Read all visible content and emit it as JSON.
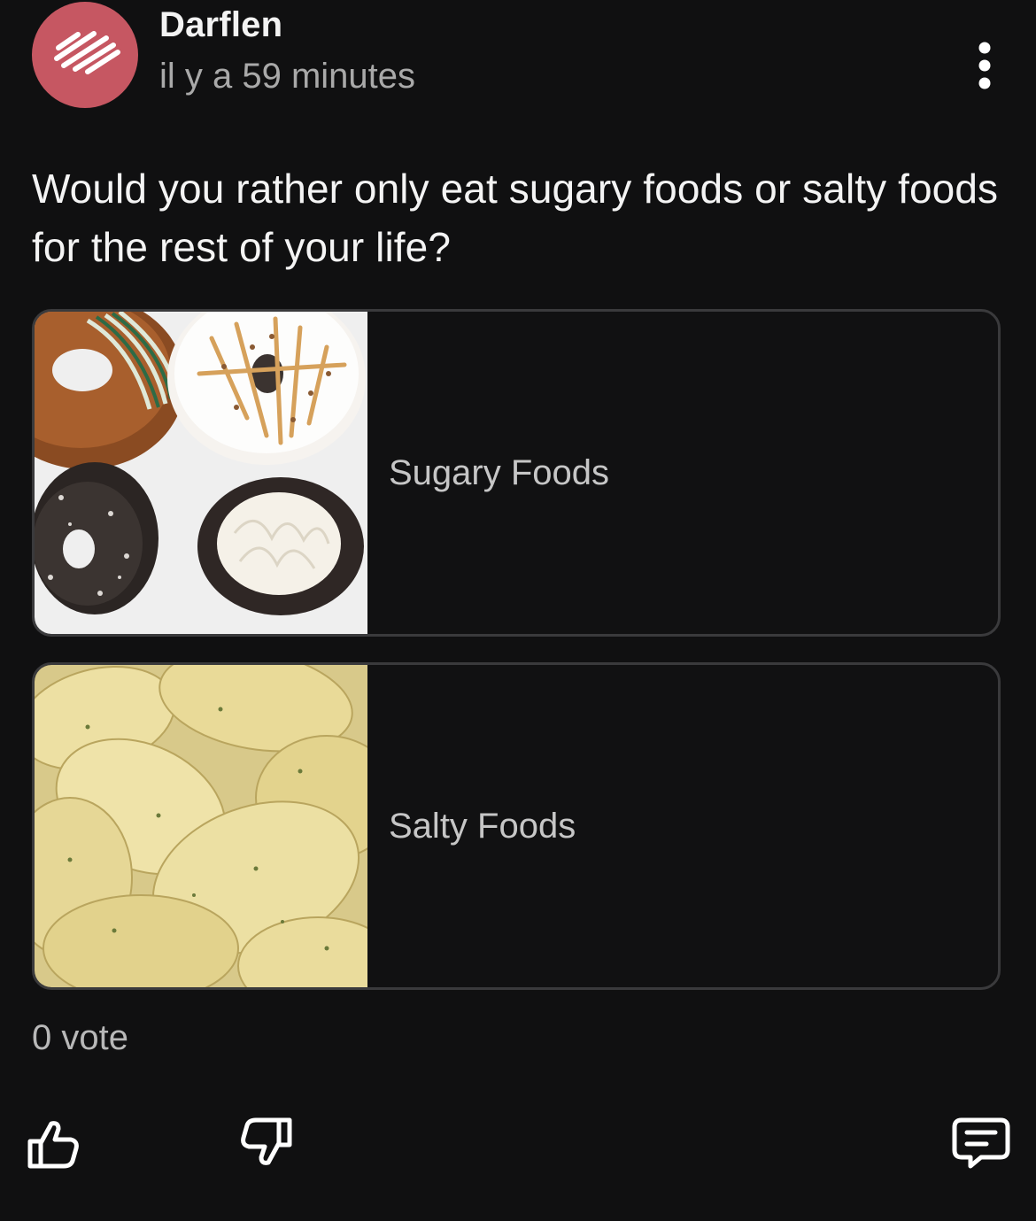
{
  "post": {
    "author": "Darflen",
    "timestamp": "il y a 59 minutes",
    "question": "Would you rather only eat sugary foods or salty foods for the rest of your life?"
  },
  "poll": {
    "options": [
      {
        "label": "Sugary Foods",
        "image": "donuts-photo"
      },
      {
        "label": "Salty Foods",
        "image": "potato-chips-photo"
      }
    ],
    "votes": "0 vote"
  },
  "icons": {
    "more": "more-vertical-icon",
    "like": "thumbs-up-icon",
    "dislike": "thumbs-down-icon",
    "comment": "comment-icon"
  },
  "colors": {
    "background": "#101011",
    "avatar": "#c65762",
    "border": "#3a3a3c",
    "text": "#f2f2f2",
    "muted": "#a9a9a9"
  }
}
